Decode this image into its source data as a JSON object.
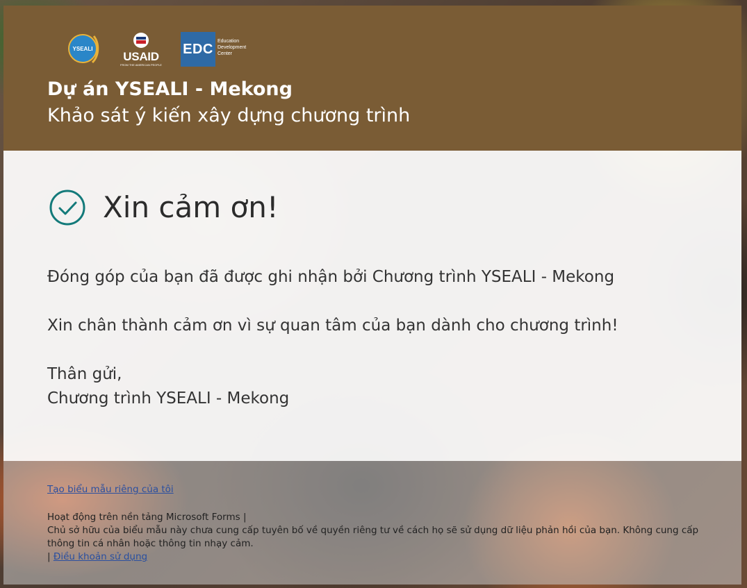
{
  "header": {
    "logos": {
      "yseali": "YSEALI",
      "usaid": "USAID",
      "usaid_tagline": "FROM THE AMERICAN PEOPLE",
      "edc": "EDC",
      "edc_line1": "Education",
      "edc_line2": "Development",
      "edc_line3": "Center"
    },
    "title": "Dự án YSEALI - Mekong",
    "subtitle": "Khảo sát ý kiến xây dựng chương trình"
  },
  "body": {
    "thanks_title": "Xin cảm ơn!",
    "message_1": "Đóng góp của bạn đã được ghi nhận bởi Chương trình YSEALI - Mekong",
    "message_2": "Xin chân thành cảm ơn vì sự quan tâm của bạn dành cho chương trình!",
    "closing": "Thân gửi,",
    "signature": "Chương trình YSEALI - Mekong",
    "check_icon": "check-circle-icon",
    "accent_color": "#137a7a"
  },
  "footer": {
    "create_link": "Tạo biểu mẫu riêng của tôi",
    "powered_by": "Hoạt động trên nền tảng Microsoft Forms |",
    "privacy_notice": "Chủ sở hữu của biểu mẫu này chưa cung cấp tuyên bố về quyền riêng tư về cách họ sẽ sử dụng dữ liệu phản hồi của bạn. Không cung cấp thông tin cá nhân hoặc thông tin nhạy cảm.",
    "terms_prefix": "|",
    "terms_link": "Điều khoản sử dụng"
  }
}
